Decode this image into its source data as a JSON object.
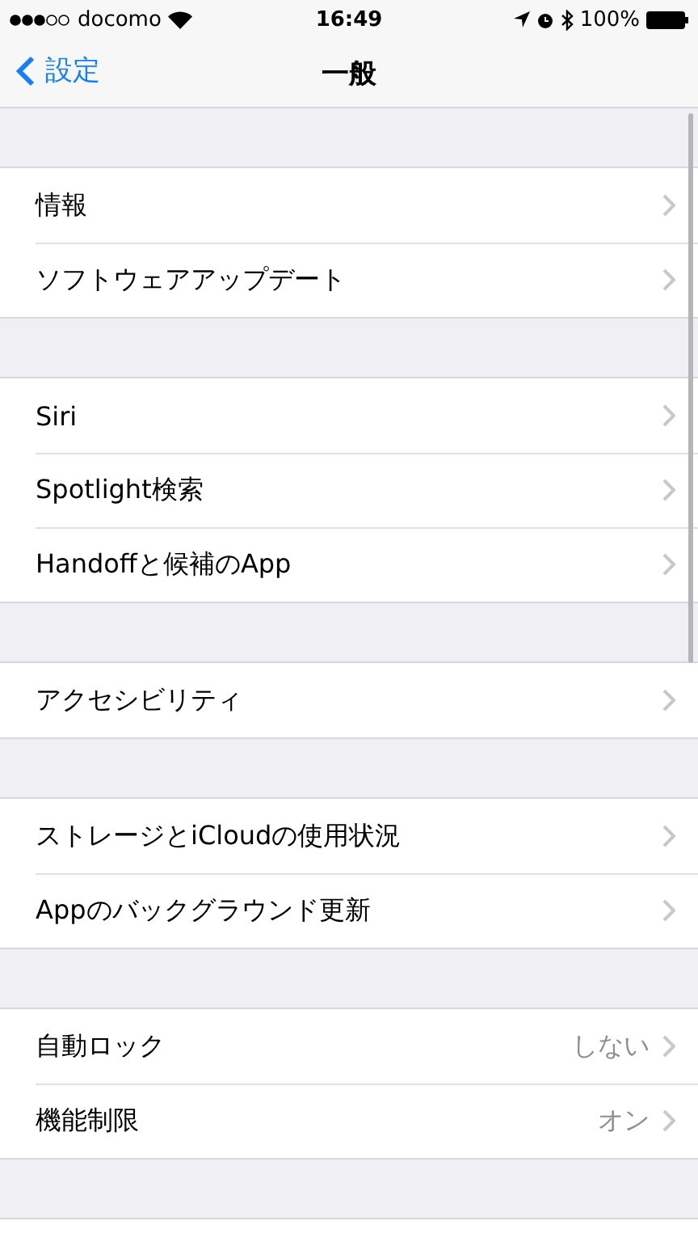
{
  "status_bar": {
    "carrier": "docomo",
    "time": "16:49",
    "battery": "100%"
  },
  "nav_bar": {
    "back": "設定",
    "title": "一般"
  },
  "groups": [
    {
      "items": [
        {
          "label": "情報"
        },
        {
          "label": "ソフトウェアアップデート"
        }
      ]
    },
    {
      "items": [
        {
          "label": "Siri"
        },
        {
          "label": "Spotlight検索"
        },
        {
          "label": "Handoffと候補のApp"
        }
      ]
    },
    {
      "items": [
        {
          "label": "アクセシビリティ"
        }
      ]
    },
    {
      "items": [
        {
          "label": "ストレージとiCloudの使用状況"
        },
        {
          "label": "Appのバックグラウンド更新"
        }
      ]
    },
    {
      "items": [
        {
          "label": "自動ロック",
          "value": "しない"
        },
        {
          "label": "機能制限",
          "value": "オン"
        }
      ]
    }
  ]
}
